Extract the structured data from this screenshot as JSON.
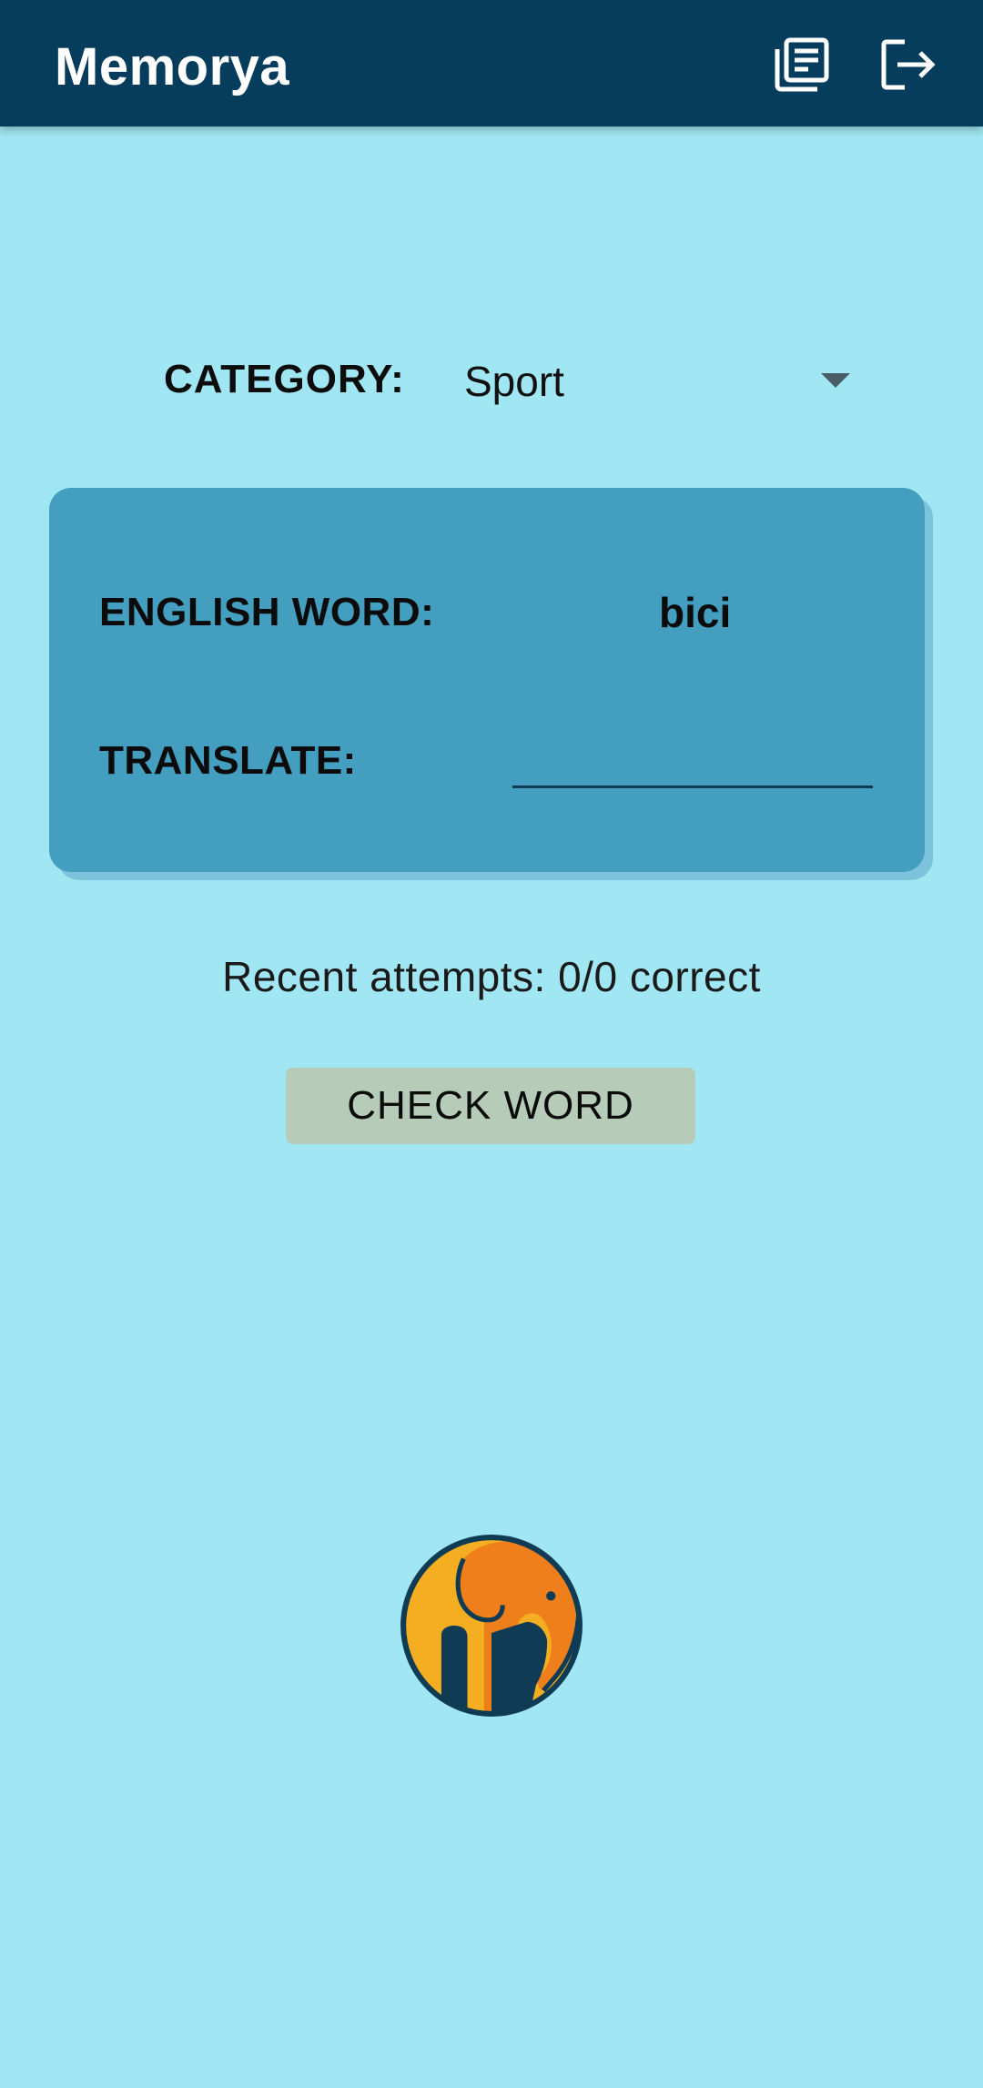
{
  "app": {
    "title": "Memorya"
  },
  "icons": {
    "list": "word-list-icon",
    "logout": "logout-icon",
    "dropdown": "dropdown-arrow-icon",
    "logo": "elephant-logo"
  },
  "category": {
    "label": "CATEGORY:",
    "selected": "Sport"
  },
  "quiz": {
    "english_label": "ENGLISH WORD:",
    "word": "bici",
    "translate_label": "TRANSLATE:",
    "translate_value": "",
    "translate_placeholder": ""
  },
  "stats": {
    "attempts_text": "Recent attempts: 0/0 correct"
  },
  "actions": {
    "check_label": "CHECK WORD"
  },
  "colors": {
    "background": "#a0e6f3",
    "appbar": "#063c5c",
    "card": "#439ebf",
    "button": "#b6ccb9",
    "logo_orange": "#ee7f1b",
    "logo_yellow": "#f5ad22",
    "logo_navy": "#0f3b55"
  }
}
